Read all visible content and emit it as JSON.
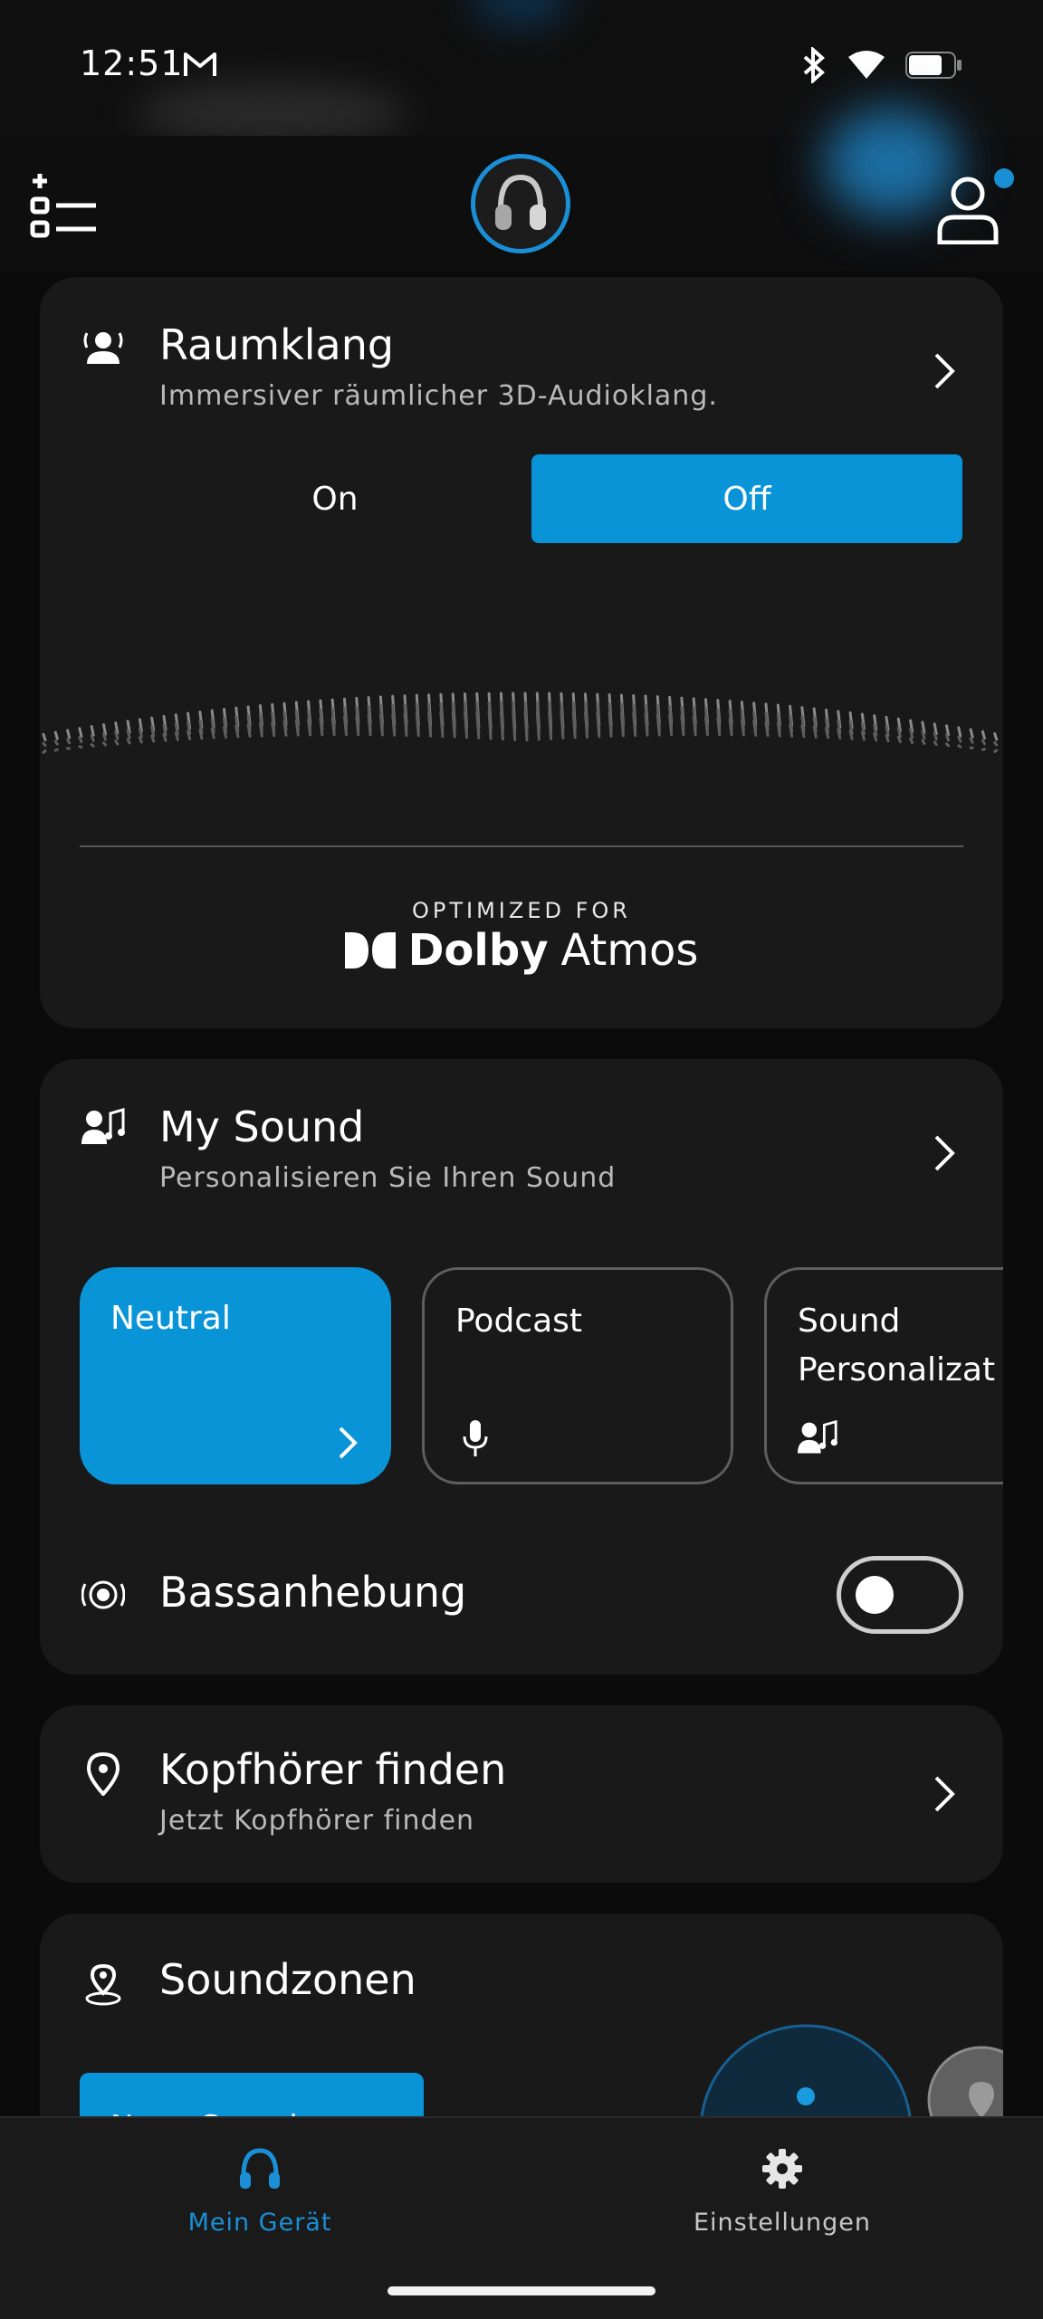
{
  "status_bar": {
    "time": "12:51",
    "mail_icon": "gmail-icon",
    "icons": [
      "bluetooth-icon",
      "wifi-icon",
      "battery-icon"
    ]
  },
  "header": {
    "menu_icon": "add-list-icon",
    "device_icon": "headphones-icon",
    "profile_icon": "profile-icon",
    "notification_dot": true
  },
  "raumklang": {
    "title": "Raumklang",
    "subtitle": "Immersiver räumlicher 3D-Audioklang.",
    "options": {
      "on": "On",
      "off": "Off",
      "selected": "Off"
    },
    "dolby_caption": "OPTIMIZED FOR",
    "dolby_brand": "Dolby",
    "dolby_suffix": "Atmos"
  },
  "my_sound": {
    "title": "My Sound",
    "subtitle": "Personalisieren Sie Ihren Sound",
    "presets": [
      {
        "label": "Neutral",
        "icon": "chevron-right-icon",
        "selected": true
      },
      {
        "label": "Podcast",
        "icon": "microphone-icon",
        "selected": false
      },
      {
        "label": "Sound Personalizat",
        "icon": "personal-music-icon",
        "selected": false
      }
    ],
    "bass_label": "Bassanhebung",
    "bass_enabled": false
  },
  "find": {
    "title": "Kopfhörer finden",
    "subtitle": "Jetzt Kopfhörer finden"
  },
  "soundzones": {
    "title": "Soundzonen",
    "button_label": "Neue Soundzone"
  },
  "bottom_nav": [
    {
      "label": "Mein Gerät",
      "icon": "headphones-icon",
      "active": true
    },
    {
      "label": "Einstellungen",
      "icon": "gear-icon",
      "active": false
    }
  ],
  "colors": {
    "accent": "#0a94d8",
    "background": "#0b0b0c",
    "card": "#191919",
    "nav_active": "#1a8fd6"
  }
}
